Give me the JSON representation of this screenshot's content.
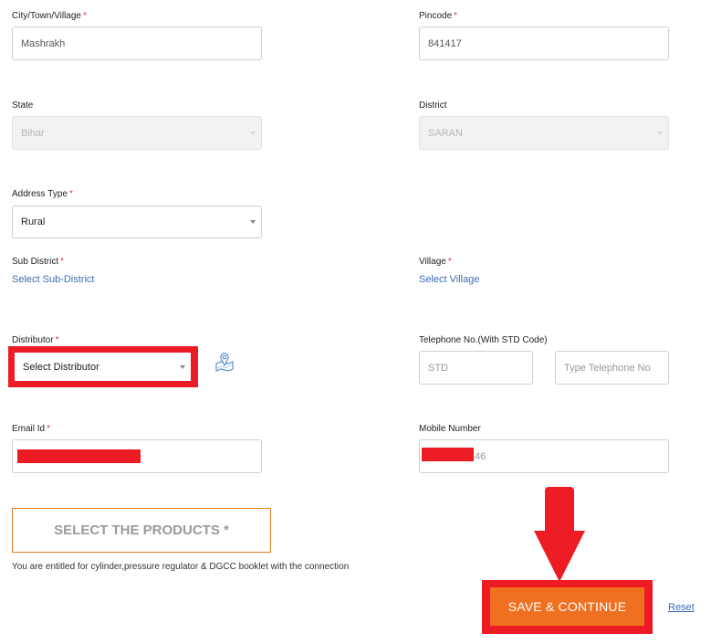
{
  "form": {
    "city": {
      "label": "City/Town/Village",
      "required": "*",
      "value": "Mashrakh"
    },
    "pincode": {
      "label": "Pincode",
      "required": "*",
      "value": "841417"
    },
    "state": {
      "label": "State",
      "value": "Bihar"
    },
    "district": {
      "label": "District",
      "value": "SARAN"
    },
    "address_type": {
      "label": "Address Type",
      "required": "*",
      "value": "Rural"
    },
    "sub_district": {
      "label": "Sub District",
      "required": "*",
      "link": "Select Sub-District"
    },
    "village": {
      "label": "Village",
      "required": "*",
      "link": "Select Village"
    },
    "distributor": {
      "label": "Distributor",
      "required": "*",
      "value": "Select Distributor",
      "map_icon": "map-pin-icon"
    },
    "telephone": {
      "label": "Telephone No.(With STD Code)",
      "std_placeholder": "STD",
      "number_placeholder": "Type Telephone No"
    },
    "email": {
      "label": "Email Id",
      "required": "*",
      "value_redacted": true
    },
    "mobile": {
      "label": "Mobile Number",
      "visible_suffix": "46",
      "value_redacted": true
    }
  },
  "products": {
    "button_label": "SELECT THE PRODUCTS *",
    "note": "You are entitled for cylinder,pressure regulator & DGCC booklet with the connection"
  },
  "actions": {
    "save_label": "SAVE & CONTINUE",
    "reset_label": "Reset"
  },
  "colors": {
    "accent": "#f07022",
    "annotation_red": "#ed1c24",
    "link": "#3a6db5"
  }
}
